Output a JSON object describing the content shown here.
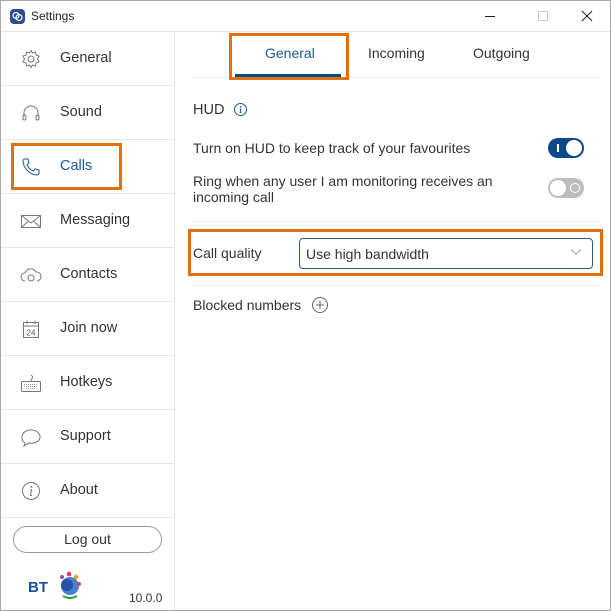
{
  "window": {
    "title": "Settings",
    "controls": {
      "minimize": "minimize-icon",
      "maximize": "maximize-icon",
      "close": "close-icon"
    }
  },
  "sidebar": {
    "items": [
      {
        "label": "General",
        "icon": "gear-icon",
        "active": false
      },
      {
        "label": "Sound",
        "icon": "headphones-icon",
        "active": false
      },
      {
        "label": "Calls",
        "icon": "phone-icon",
        "active": true
      },
      {
        "label": "Messaging",
        "icon": "envelope-icon",
        "active": false
      },
      {
        "label": "Contacts",
        "icon": "cloud-contacts-icon",
        "active": false
      },
      {
        "label": "Join now",
        "icon": "calendar-icon",
        "active": false
      },
      {
        "label": "Hotkeys",
        "icon": "keyboard-icon",
        "active": false
      },
      {
        "label": "Support",
        "icon": "speech-bubble-icon",
        "active": false
      },
      {
        "label": "About",
        "icon": "info-icon",
        "active": false
      }
    ],
    "calendar_day": "24",
    "logout_label": "Log out",
    "brand": "BT",
    "version": "10.0.0"
  },
  "main": {
    "tabs": [
      {
        "label": "General",
        "active": true
      },
      {
        "label": "Incoming",
        "active": false
      },
      {
        "label": "Outgoing",
        "active": false
      }
    ],
    "hud": {
      "title": "HUD",
      "settings": [
        {
          "label": "Turn on HUD to keep track of your favourites",
          "enabled": true
        },
        {
          "label": "Ring when any user I am monitoring receives an incoming call",
          "enabled": false
        }
      ]
    },
    "call_quality": {
      "label": "Call quality",
      "selected": "Use high bandwidth"
    },
    "blocked_numbers": {
      "label": "Blocked numbers"
    }
  },
  "colors": {
    "accent": "#0b4a85",
    "highlight": "#e07010",
    "active_text": "#1a5a96"
  }
}
